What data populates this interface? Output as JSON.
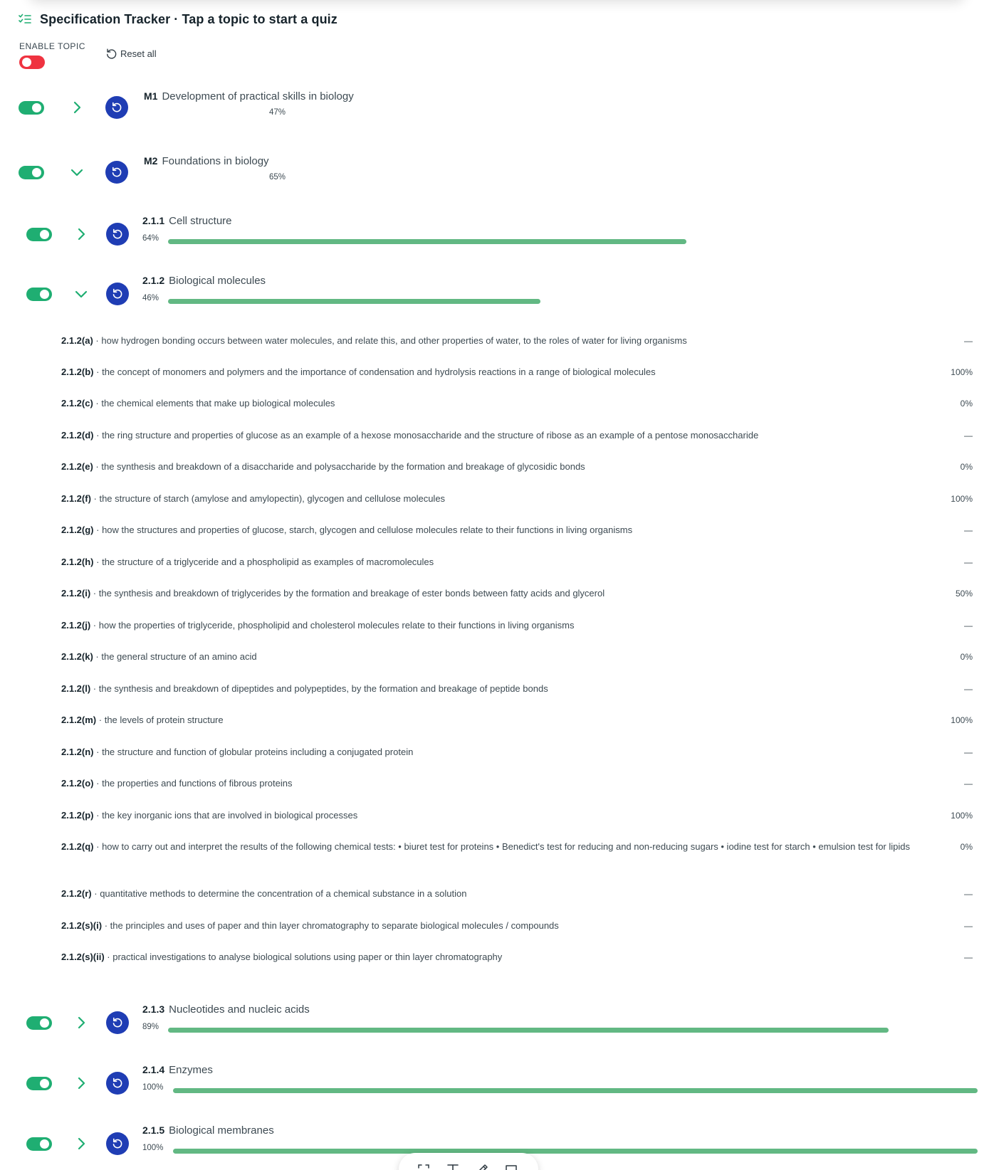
{
  "header": {
    "title": "Specification Tracker · Tap a topic to start a quiz",
    "icon": "checklist-icon"
  },
  "controls": {
    "enable_label": "ENABLE TOPIC",
    "enable_state": "off",
    "reset_all_label": "Reset all"
  },
  "colors": {
    "toggle_on": "#1fae72",
    "toggle_off": "#ef3340",
    "reset_button": "#1f3db4",
    "progress_bar": "#62b883",
    "chevron": "#1fae72"
  },
  "topics": [
    {
      "code": "M1",
      "name": "Development of practical skills in biology",
      "percent_label": "47%",
      "progress": 47,
      "expanded": false,
      "enabled": true
    },
    {
      "code": "M2",
      "name": "Foundations in biology",
      "percent_label": "65%",
      "progress": 65,
      "expanded": true,
      "enabled": true
    },
    {
      "code": "2.1.1",
      "name": "Cell structure",
      "percent_label": "64%",
      "progress": 64,
      "expanded": false,
      "enabled": true
    },
    {
      "code": "2.1.2",
      "name": "Biological molecules",
      "percent_label": "46%",
      "progress": 46,
      "expanded": true,
      "enabled": true
    },
    {
      "code": "2.1.3",
      "name": "Nucleotides and nucleic acids",
      "percent_label": "89%",
      "progress": 89,
      "expanded": false,
      "enabled": true
    },
    {
      "code": "2.1.4",
      "name": "Enzymes",
      "percent_label": "100%",
      "progress": 100,
      "expanded": false,
      "enabled": true
    },
    {
      "code": "2.1.5",
      "name": "Biological membranes",
      "percent_label": "100%",
      "progress": 100,
      "expanded": false,
      "enabled": true
    }
  ],
  "sub_items": [
    {
      "code": "2.1.2(a)",
      "text": "how hydrogen bonding occurs between water molecules, and relate this, and other properties of water, to the roles of water for living organisms",
      "score": "—"
    },
    {
      "code": "2.1.2(b)",
      "text": "the concept of monomers and polymers and the importance of condensation and hydrolysis reactions in a range of biological molecules",
      "score": "100%"
    },
    {
      "code": "2.1.2(c)",
      "text": "the chemical elements that make up biological molecules",
      "score": "0%"
    },
    {
      "code": "2.1.2(d)",
      "text": "the ring structure and properties of glucose as an example of a hexose monosaccharide and the structure of ribose as an example of a pentose monosaccharide",
      "score": "—"
    },
    {
      "code": "2.1.2(e)",
      "text": "the synthesis and breakdown of a disaccharide and polysaccharide by the formation and breakage of glycosidic bonds",
      "score": "0%"
    },
    {
      "code": "2.1.2(f)",
      "text": "the structure of starch (amylose and amylopectin), glycogen and cellulose molecules",
      "score": "100%"
    },
    {
      "code": "2.1.2(g)",
      "text": "how the structures and properties of glucose, starch, glycogen and cellulose molecules relate to their functions in living organisms",
      "score": "—"
    },
    {
      "code": "2.1.2(h)",
      "text": "the structure of a triglyceride and a phospholipid as examples of macromolecules",
      "score": "—"
    },
    {
      "code": "2.1.2(i)",
      "text": "the synthesis and breakdown of triglycerides by the formation and breakage of ester bonds between fatty acids and glycerol",
      "score": "50%"
    },
    {
      "code": "2.1.2(j)",
      "text": "how the properties of triglyceride, phospholipid and cholesterol molecules relate to their functions in living organisms",
      "score": "—"
    },
    {
      "code": "2.1.2(k)",
      "text": "the general structure of an amino acid",
      "score": "0%"
    },
    {
      "code": "2.1.2(l)",
      "text": "the synthesis and breakdown of dipeptides and polypeptides, by the formation and breakage of peptide bonds",
      "score": "—"
    },
    {
      "code": "2.1.2(m)",
      "text": "the levels of protein structure",
      "score": "100%"
    },
    {
      "code": "2.1.2(n)",
      "text": "the structure and function of globular proteins including a conjugated protein",
      "score": "—"
    },
    {
      "code": "2.1.2(o)",
      "text": "the properties and functions of fibrous proteins",
      "score": "—"
    },
    {
      "code": "2.1.2(p)",
      "text": "the key inorganic ions that are involved in biological processes",
      "score": "100%"
    },
    {
      "code": "2.1.2(q)",
      "text": "how to carry out and interpret the results of the following chemical tests: • biuret test for proteins • Benedict's test for reducing and non-reducing sugars • iodine test for starch • emulsion test for lipids",
      "score": "0%"
    },
    {
      "code": "2.1.2(r)",
      "text": "quantitative methods to determine the concentration of a chemical substance in a solution",
      "score": "—"
    },
    {
      "code": "2.1.2(s)(i)",
      "text": "the principles and uses of paper and thin layer chromatography to separate biological molecules / compounds",
      "score": "—"
    },
    {
      "code": "2.1.2(s)(ii)",
      "text": "practical investigations to analyse biological solutions using paper or thin layer chromatography",
      "score": "—"
    }
  ],
  "separator": "·",
  "floating_toolbar": {
    "icons": [
      "select-area-icon",
      "text-icon",
      "pen-icon",
      "comment-icon"
    ]
  }
}
